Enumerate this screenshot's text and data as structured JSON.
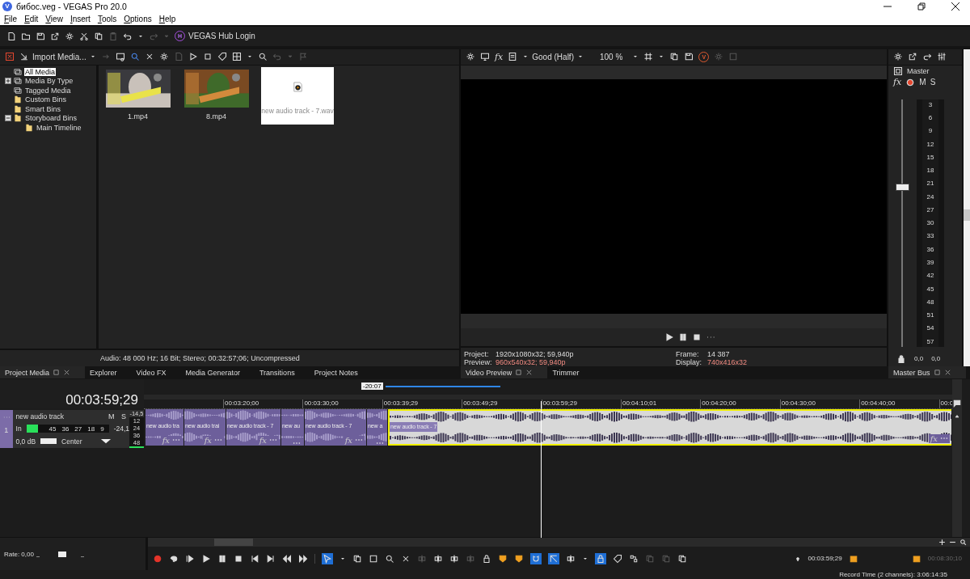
{
  "window": {
    "app_badge": "V",
    "title": "бибос.veg - VEGAS Pro 20.0"
  },
  "menu": [
    "File",
    "Edit",
    "View",
    "Insert",
    "Tools",
    "Options",
    "Help"
  ],
  "toolbar": {
    "hub_badge": "H",
    "hub_login": "VEGAS Hub Login"
  },
  "media_panel": {
    "import_label": "Import Media...",
    "tree": [
      {
        "label": "All Media",
        "selected": true,
        "kind": "view"
      },
      {
        "label": "Media By Type",
        "selected": false,
        "kind": "view",
        "expanded": false
      },
      {
        "label": "Tagged Media",
        "selected": false,
        "kind": "view"
      },
      {
        "label": "Custom Bins",
        "selected": false,
        "kind": "bin"
      },
      {
        "label": "Smart Bins",
        "selected": false,
        "kind": "bin"
      },
      {
        "label": "Storyboard Bins",
        "selected": false,
        "kind": "bin",
        "expanded": true,
        "children": [
          {
            "label": "Main Timeline",
            "selected": false,
            "kind": "bin"
          }
        ]
      }
    ],
    "media": [
      {
        "name": "1.mp4",
        "kind": "video"
      },
      {
        "name": "8.mp4",
        "kind": "video"
      },
      {
        "name": "new audio track - 7.wav",
        "kind": "audio"
      }
    ],
    "status": "Audio: 48 000 Hz; 16 Bit; Stereo; 00:32:57;06; Uncompressed",
    "tabs": [
      {
        "label": "Project Media",
        "selected": true
      },
      {
        "label": "Explorer",
        "selected": false
      },
      {
        "label": "Video FX",
        "selected": false
      },
      {
        "label": "Media Generator",
        "selected": false
      },
      {
        "label": "Transitions",
        "selected": false
      },
      {
        "label": "Project Notes",
        "selected": false
      }
    ]
  },
  "preview": {
    "fx_label": "fx",
    "quality": "Good (Half)",
    "zoom": "100 %",
    "v_badge": "V",
    "info": [
      {
        "label": "Project:",
        "value": "1920x1080x32; 59,940p",
        "highlight": false
      },
      {
        "label": "Frame:",
        "value": "14 387",
        "highlight": false
      },
      {
        "label": "Preview:",
        "value": "960x540x32; 59,940p",
        "highlight": true
      },
      {
        "label": "Display:",
        "value": "740x416x32",
        "highlight": true
      }
    ],
    "tabs": [
      {
        "label": "Video Preview",
        "selected": true
      },
      {
        "label": "Trimmer",
        "selected": false
      }
    ]
  },
  "master": {
    "label": "Master",
    "fx_label": "fx",
    "mute": "M",
    "solo": "S",
    "level": 0.65,
    "scale": [
      "3",
      "6",
      "9",
      "12",
      "15",
      "18",
      "21",
      "24",
      "27",
      "30",
      "33",
      "36",
      "39",
      "42",
      "45",
      "48",
      "51",
      "54",
      "57"
    ],
    "readings": [
      "0,0",
      "0,0"
    ],
    "tabs": [
      {
        "label": "Master Bus",
        "selected": true
      }
    ]
  },
  "timeline": {
    "time": "00:03:59;29",
    "loop_length": "-20:07",
    "ruler": [
      "00:03:20;00",
      "00:03:30;00",
      "00:03:39;29",
      "00:03:49;29",
      "00:03:59;29",
      "00:04:10;01",
      "00:04:20;00",
      "00:04:30;00",
      "00:04:40;00",
      "00:0"
    ],
    "track": {
      "number": "1",
      "name": "new audio track",
      "mute": "M",
      "solo": "S",
      "peak": "-14,5",
      "input": "In",
      "level": 0.14,
      "meter_scale": [
        "45",
        "36",
        "27",
        "18",
        "9"
      ],
      "reading": "-24,1",
      "volume": "0,0 dB",
      "pan": "Center",
      "side_scale": [
        "12",
        "24",
        "36",
        "48"
      ]
    },
    "clips": [
      {
        "label": "new audio tra",
        "selected": false,
        "fx_label": "fx"
      },
      {
        "label": "new audio trai",
        "selected": false,
        "fx_label": "fx"
      },
      {
        "label": "new audio track - 7",
        "selected": false,
        "fx_label": "fx"
      },
      {
        "label": "new au",
        "selected": false
      },
      {
        "label": "new audio track - 7",
        "selected": false,
        "fx_label": "fx"
      },
      {
        "label": "new a",
        "selected": false
      },
      {
        "label": "new audio track - 7",
        "selected": true,
        "fx_label": "fx"
      }
    ]
  },
  "bottom": {
    "rate": "Rate: 0,00",
    "cursor_time": "00:03:59;29",
    "end_time": "00:08:30;10",
    "record_time": "Record Time (2 channels): 3:06:14:35"
  }
}
